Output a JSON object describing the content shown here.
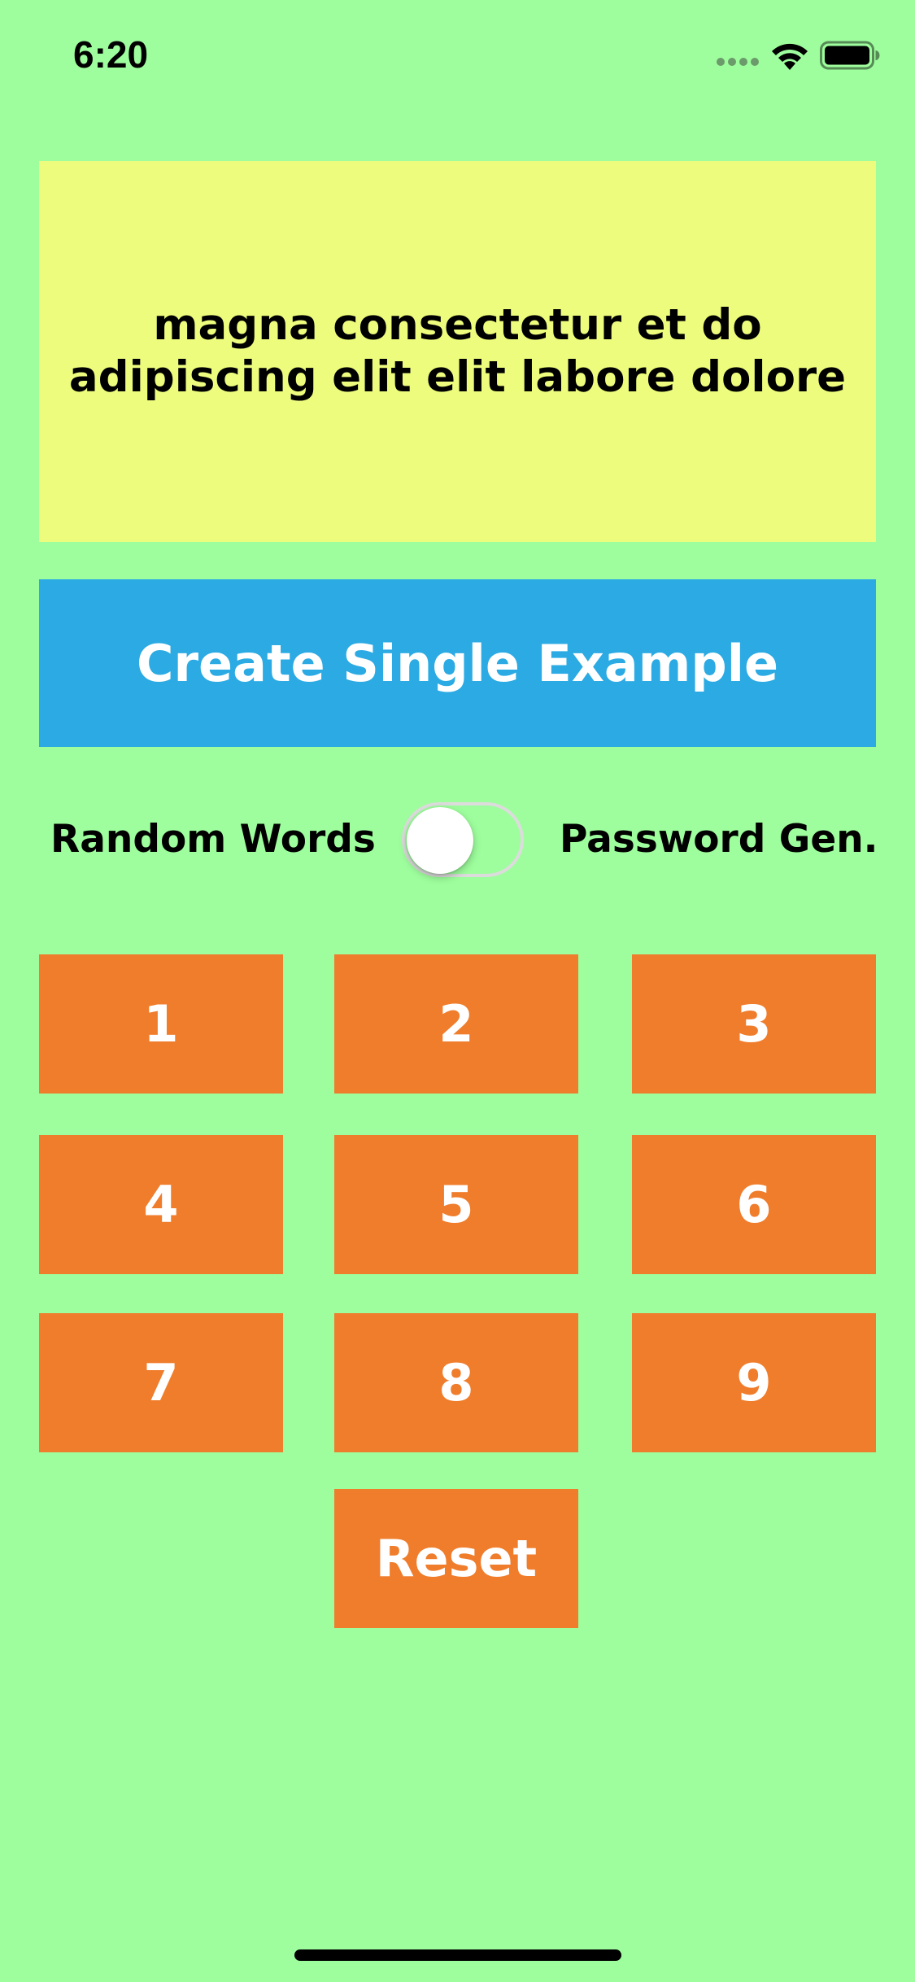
{
  "status_bar": {
    "time": "6:20",
    "icons": [
      "signal-dots-icon",
      "wifi-icon",
      "battery-icon"
    ]
  },
  "output": {
    "text": "magna consectetur et do adipiscing elit elit labore dolore"
  },
  "create_button": {
    "label": "Create Single Example"
  },
  "mode": {
    "left_label": "Random Words",
    "right_label": "Password Gen.",
    "toggle_on": false
  },
  "keypad": {
    "keys": [
      "1",
      "2",
      "3",
      "4",
      "5",
      "6",
      "7",
      "8",
      "9"
    ],
    "reset_label": "Reset"
  },
  "colors": {
    "background": "#9efe9d",
    "output_background": "#eefc7e",
    "create_button": "#2baae3",
    "keypad_button": "#ef7d2c",
    "button_text": "#ffffff"
  }
}
